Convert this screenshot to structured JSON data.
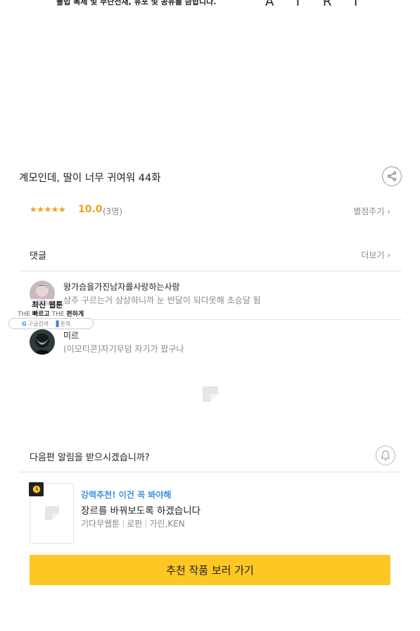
{
  "header": {
    "notice": "불법 복제 및 무단전재, 유포 및 공유를 금합니다.",
    "logo_text": "ATRT"
  },
  "episode": {
    "title": "계모인데, 딸이 너무 귀여워 44화",
    "share_icon": "share-icon"
  },
  "rating": {
    "stars": "★★★★★",
    "score": "10.0",
    "count": "(3명)",
    "rate_link": "별점주기 ›",
    "accent": "#f0a020"
  },
  "comments": {
    "title": "댓글",
    "more_link": "더보기 ›",
    "items": [
      {
        "user": "왕가슴을가진남자를사랑하는사람",
        "text": "상주 구르는거 상상하니까 눈 반달이 되다못해 초승달 됨"
      },
      {
        "user": "미르",
        "text": "(이모티콘)자기무덤 자기가 팠구나"
      }
    ]
  },
  "floating_widget": {
    "title": "최신 웹툰",
    "sub_prefix_1": "THE ",
    "sub_bold_1": "빠르고",
    "sub_prefix_2": " THE ",
    "sub_bold_2": "편하게",
    "search_label": "구글검색",
    "book_label": "툰북"
  },
  "notify": {
    "text": "다음편 알림을 받으시겠습니까?",
    "bell_icon": "bell-icon"
  },
  "recommendation": {
    "tag": "강력추천! 이건 꼭 봐야해",
    "title": "장르를 바꿔보도록 하겠습니다",
    "genre": "기다무웹툰",
    "category": "로판",
    "authors": "가린,KEN",
    "tag_color": "#3d8fe0"
  },
  "cta": {
    "label": "추천 작품 보러 가기",
    "color": "#fec723"
  }
}
